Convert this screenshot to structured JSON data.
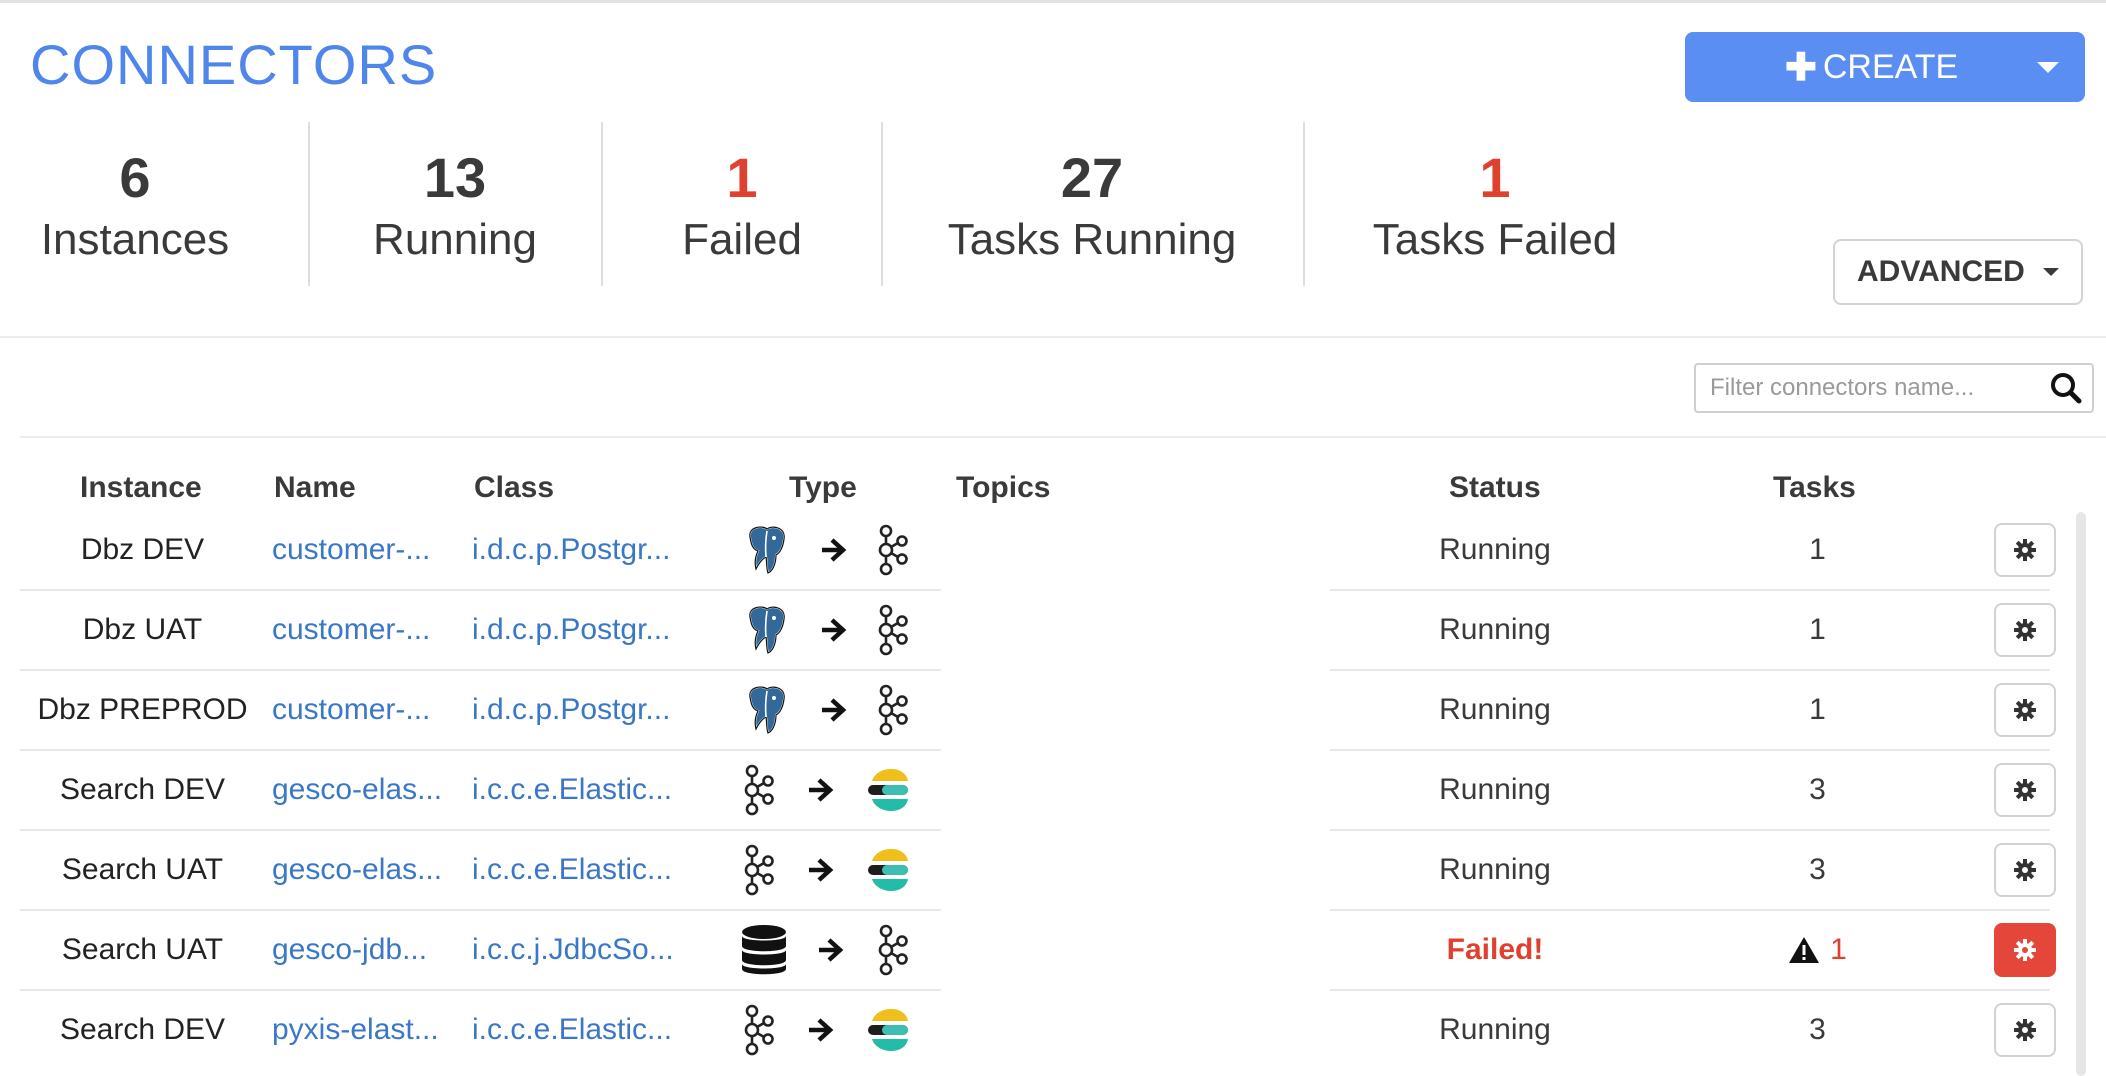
{
  "page": {
    "title": "CONNECTORS"
  },
  "create_button": {
    "label": "CREATE"
  },
  "stats": [
    {
      "value": "6",
      "label": "Instances",
      "alert": false
    },
    {
      "value": "13",
      "label": "Running",
      "alert": false
    },
    {
      "value": "1",
      "label": "Failed",
      "alert": true
    },
    {
      "value": "27",
      "label": "Tasks Running",
      "alert": false
    },
    {
      "value": "1",
      "label": "Tasks Failed",
      "alert": true
    }
  ],
  "advanced_button": {
    "label": "ADVANCED"
  },
  "search": {
    "placeholder": "Filter connectors name...",
    "value": ""
  },
  "table": {
    "headers": {
      "instance": "Instance",
      "name": "Name",
      "class": "Class",
      "type": "Type",
      "topics": "Topics",
      "status": "Status",
      "tasks": "Tasks"
    },
    "rows": [
      {
        "instance": "Dbz DEV",
        "name": "customer-...",
        "class": "i.d.c.p.Postgr...",
        "source_icon": "postgresql-icon",
        "sink_icon": "kafka-icon",
        "status": "Running",
        "tasks": "1",
        "failed": false
      },
      {
        "instance": "Dbz UAT",
        "name": "customer-...",
        "class": "i.d.c.p.Postgr...",
        "source_icon": "postgresql-icon",
        "sink_icon": "kafka-icon",
        "status": "Running",
        "tasks": "1",
        "failed": false
      },
      {
        "instance": "Dbz PREPROD",
        "name": "customer-...",
        "class": "i.d.c.p.Postgr...",
        "source_icon": "postgresql-icon",
        "sink_icon": "kafka-icon",
        "status": "Running",
        "tasks": "1",
        "failed": false
      },
      {
        "instance": "Search DEV",
        "name": "gesco-elas...",
        "class": "i.c.c.e.Elastic...",
        "source_icon": "kafka-icon",
        "sink_icon": "elasticsearch-icon",
        "status": "Running",
        "tasks": "3",
        "failed": false
      },
      {
        "instance": "Search UAT",
        "name": "gesco-elas...",
        "class": "i.c.c.e.Elastic...",
        "source_icon": "kafka-icon",
        "sink_icon": "elasticsearch-icon",
        "status": "Running",
        "tasks": "3",
        "failed": false
      },
      {
        "instance": "Search UAT",
        "name": "gesco-jdb...",
        "class": "i.c.c.j.JdbcSo...",
        "source_icon": "database-icon",
        "sink_icon": "kafka-icon",
        "status": "Failed!",
        "tasks": "1",
        "failed": true
      },
      {
        "instance": "Search DEV",
        "name": "pyxis-elast...",
        "class": "i.c.c.e.Elastic...",
        "source_icon": "kafka-icon",
        "sink_icon": "elasticsearch-icon",
        "status": "Running",
        "tasks": "3",
        "failed": false
      }
    ]
  },
  "colors": {
    "accent": "#4f86ec",
    "button": "#5a8ef2",
    "link": "#3a78c7",
    "danger": "#e0412f",
    "text": "#3a3a3a"
  }
}
